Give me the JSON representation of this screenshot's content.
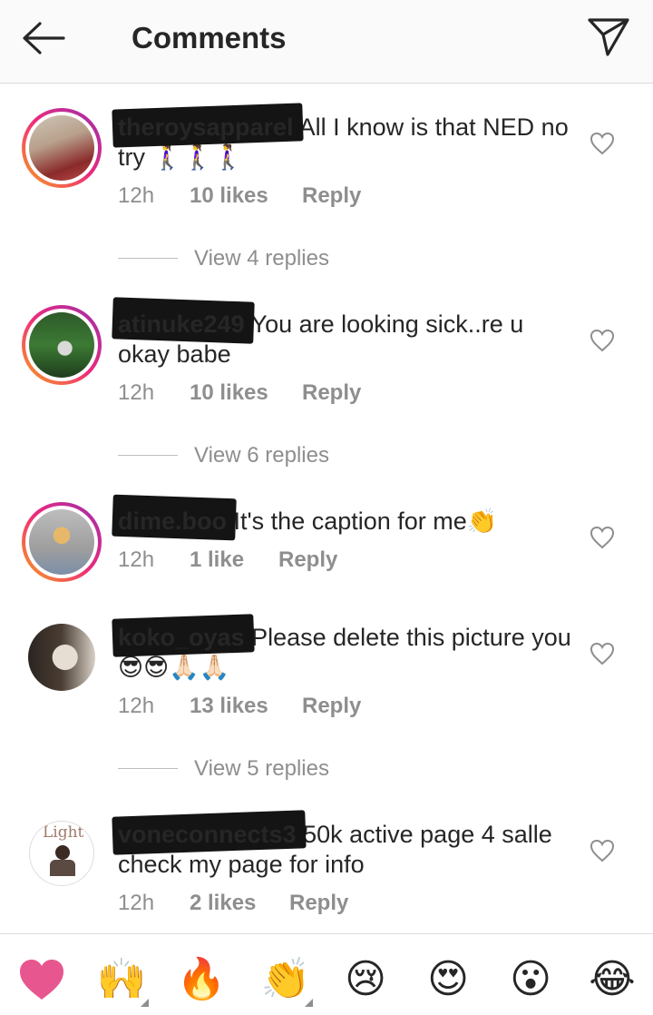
{
  "header": {
    "title": "Comments",
    "back_icon": "arrow-left-icon",
    "send_icon": "paper-plane-icon"
  },
  "comments": [
    {
      "username": "theroysapparel",
      "text": "All I know is that NED no try 🚶‍♀️🚶‍♀️🚶‍♀️",
      "time": "12h",
      "likes": "10 likes",
      "reply": "Reply"
    },
    {
      "username": "atinuke249",
      "text": "You are looking sick..re u okay babe",
      "time": "12h",
      "likes": "10 likes",
      "reply": "Reply"
    },
    {
      "username": "dime.boo",
      "text": "It's the caption for me👏",
      "time": "12h",
      "likes": "1 like",
      "reply": "Reply"
    },
    {
      "username": "koko_oyas",
      "text": "Please delete this picture you 😎😎🙏🏻🙏🏻",
      "time": "12h",
      "likes": "13 likes",
      "reply": "Reply"
    },
    {
      "username": "voneconnects3",
      "text": "50k active page 4 salle check my page for info",
      "time": "12h",
      "likes": "2 likes",
      "reply": "Reply"
    }
  ],
  "view_replies": [
    "View 4 replies",
    "View 6 replies",
    "View 5 replies"
  ],
  "avatars": {
    "light_label": "Light"
  },
  "emoji_bar": [
    "❤",
    "🙌",
    "🔥",
    "👏",
    "😢",
    "😍",
    "😮",
    "😂"
  ],
  "colors": {
    "heart": "#ed4956",
    "meta": "#8e8e8e",
    "ring_start": "#f9a31b",
    "ring_end": "#9b2fae"
  }
}
